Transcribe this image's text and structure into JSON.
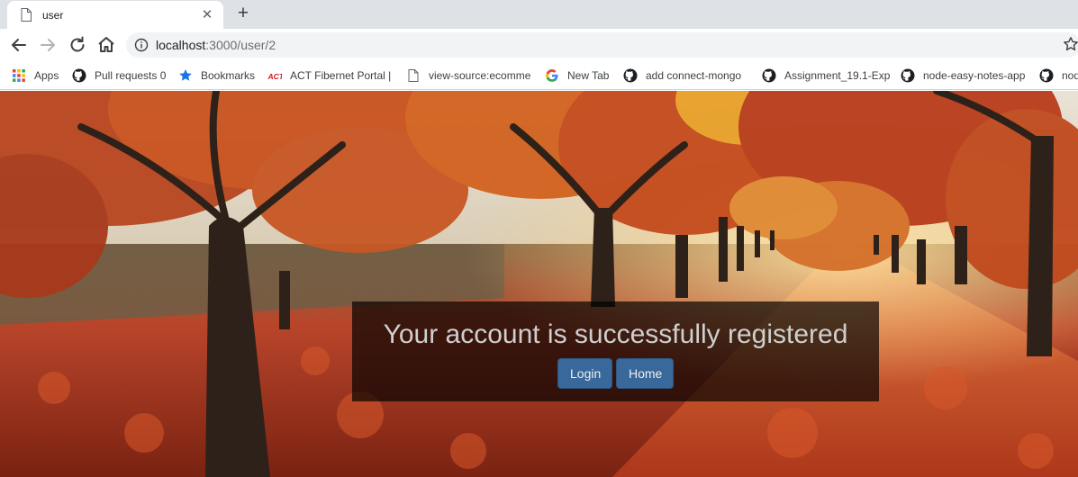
{
  "browser": {
    "tab": {
      "title": "user",
      "close_glyph": "✕",
      "icon": "page-icon"
    },
    "new_tab_glyph": "+",
    "toolbar": {
      "back_icon": "back-arrow-icon",
      "forward_icon": "forward-arrow-icon",
      "reload_icon": "reload-icon",
      "home_icon": "home-icon"
    },
    "omnibox": {
      "host": "localhost",
      "path": ":3000/user/2",
      "info_icon": "info-icon",
      "star_icon": "star-icon"
    },
    "bookmarks": [
      {
        "label": "Apps",
        "icon": "apps-grid-icon"
      },
      {
        "label": "Pull requests 0",
        "icon": "github-icon"
      },
      {
        "label": "Bookmarks",
        "icon": "star-icon"
      },
      {
        "label": "ACT Fibernet Portal |",
        "icon": "act-logo-icon"
      },
      {
        "label": "view-source:ecomme",
        "icon": "page-icon"
      },
      {
        "label": "New Tab",
        "icon": "google-icon"
      },
      {
        "label": "add connect-mongo",
        "icon": "github-icon"
      },
      {
        "label": "Assignment_19.1-Exp",
        "icon": "github-icon"
      },
      {
        "label": "node-easy-notes-app",
        "icon": "github-icon"
      },
      {
        "label": "node",
        "icon": "github-icon"
      }
    ]
  },
  "page": {
    "message": "Your account is successfully registered",
    "buttons": {
      "login": "Login",
      "home": "Home"
    },
    "colors": {
      "button": "#3a6fa6",
      "panel": "rgba(0,0,0,0.68)"
    }
  }
}
